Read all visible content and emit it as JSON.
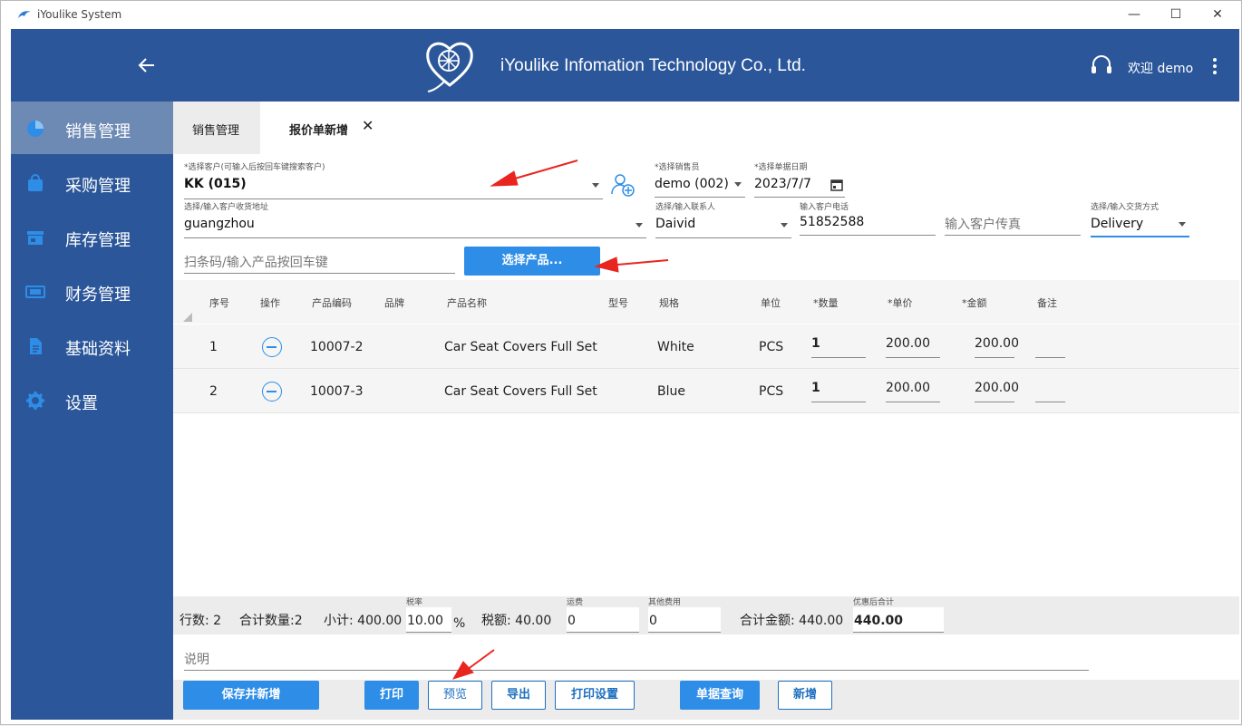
{
  "window": {
    "title": "iYoulike System"
  },
  "header": {
    "company": "iYoulike Infomation Technology Co., Ltd.",
    "welcome": "欢迎 demo"
  },
  "sidebar": {
    "items": [
      {
        "label": "销售管理",
        "icon": "pie-chart-icon",
        "active": true
      },
      {
        "label": "采购管理",
        "icon": "shopping-bag-icon"
      },
      {
        "label": "库存管理",
        "icon": "store-icon"
      },
      {
        "label": "财务管理",
        "icon": "money-icon"
      },
      {
        "label": "基础资料",
        "icon": "document-icon"
      },
      {
        "label": "设置",
        "icon": "gear-icon"
      }
    ]
  },
  "tabs": {
    "tab1": "销售管理",
    "tab2": "报价单新增",
    "close": "✕"
  },
  "form": {
    "customer_label": "*选择客户(可输入后按回车键搜索客户)",
    "customer_value": "KK (015)",
    "salesman_label": "*选择销售员",
    "salesman_value": "demo (002)",
    "date_label": "*选择单据日期",
    "date_value": "2023/7/7",
    "address_label": "选择/输入客户收货地址",
    "address_value": "guangzhou",
    "contact_label": "选择/输入联系人",
    "contact_value": "Daivid",
    "phone_label": "输入客户电话",
    "phone_value": "51852588",
    "fax_placeholder": "输入客户传真",
    "delivery_label": "选择/输入交货方式",
    "delivery_value": "Delivery",
    "barcode_placeholder": "扫条码/输入产品按回车键",
    "select_product_button": "选择产品..."
  },
  "table": {
    "headers": [
      "序号",
      "操作",
      "产品编码",
      "品牌",
      "产品名称",
      "型号",
      "规格",
      "单位",
      "*数量",
      "*单价",
      "*金额",
      "备注"
    ],
    "rows": [
      {
        "no": "1",
        "code": "10007-2",
        "brand": "",
        "name": "Car Seat Covers Full Set",
        "model": "",
        "spec": "White",
        "unit": "PCS",
        "qty": "1",
        "price": "200.00",
        "amount": "200.00",
        "note": ""
      },
      {
        "no": "2",
        "code": "10007-3",
        "brand": "",
        "name": "Car Seat Covers Full Set",
        "model": "",
        "spec": "Blue",
        "unit": "PCS",
        "qty": "1",
        "price": "200.00",
        "amount": "200.00",
        "note": ""
      }
    ]
  },
  "totals": {
    "rows": "行数: 2",
    "qty": "合计数量:2",
    "subtotal": "小计: 400.00",
    "tax_rate_label": "税率",
    "tax_rate_value": "10.00",
    "percent": "%",
    "tax": "税额: 40.00",
    "freight_label": "运费",
    "freight_value": "0",
    "other_label": "其他费用",
    "other_value": "0",
    "total": "合计金额:  440.00",
    "discounted_label": "优惠后合计",
    "discounted_value": "440.00"
  },
  "remark_placeholder": "说明",
  "buttons": {
    "save_new": "保存并新增",
    "print": "打印",
    "preview": "预览",
    "export": "导出",
    "print_settings": "打印设置",
    "query": "单据查询",
    "new": "新增"
  },
  "colors": {
    "header": "#2b579a",
    "sidebar_active": "#6d8ab5",
    "accent": "#2e8de6",
    "annotation_arrow": "#e8261f"
  }
}
